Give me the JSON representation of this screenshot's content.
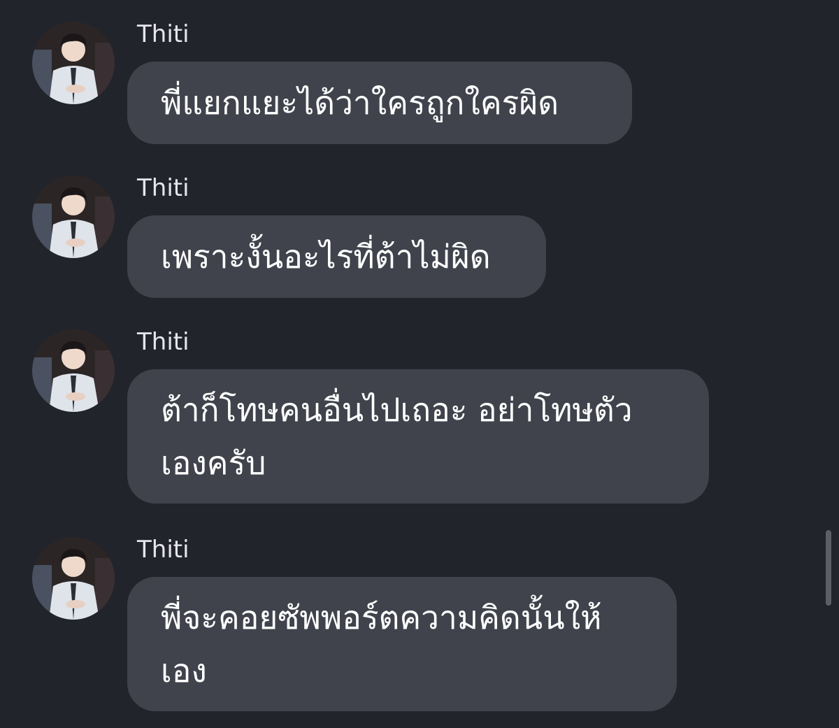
{
  "messages": [
    {
      "sender": "Thiti",
      "lines": [
        "พี่แยกแยะได้ว่าใครถูกใครผิด"
      ]
    },
    {
      "sender": "Thiti",
      "lines": [
        "เพราะงั้นอะไรที่ต้าไม่ผิด"
      ]
    },
    {
      "sender": "Thiti",
      "lines": [
        "ต้าก็โทษคนอื่นไปเถอะ อย่าโทษตัว",
        "เองครับ"
      ]
    },
    {
      "sender": "Thiti",
      "lines": [
        "พี่จะคอยซัพพอร์ตความคิดนั้นให้",
        "เอง"
      ]
    }
  ],
  "colors": {
    "background": "#22242b",
    "bubble": "#40434c",
    "text": "#ffffff",
    "sender": "#e6e6ea"
  },
  "icons": {
    "avatar": "profile-photo"
  }
}
